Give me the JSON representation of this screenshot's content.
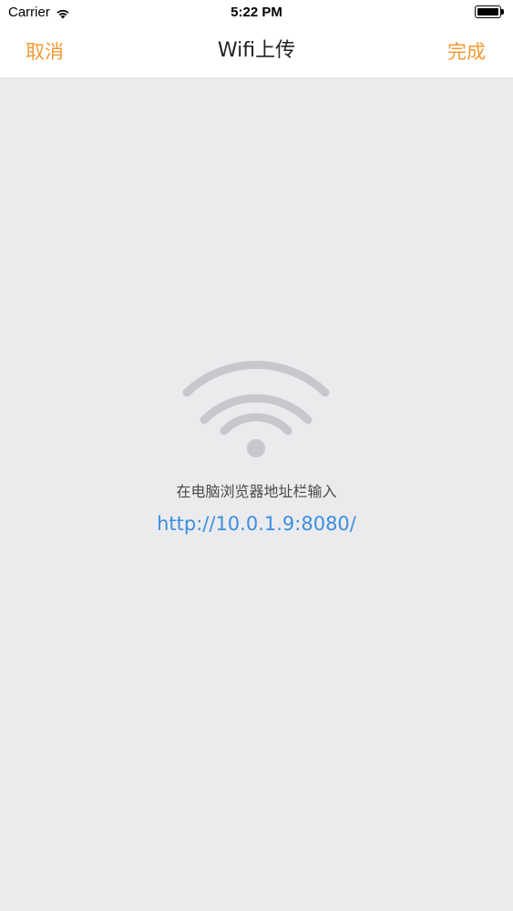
{
  "status_bar": {
    "carrier": "Carrier",
    "time": "5:22 PM",
    "signal_icon": "wifi-signal-icon",
    "battery_icon": "battery-icon"
  },
  "nav": {
    "cancel_label": "取消",
    "title": "Wifi上传",
    "done_label": "完成",
    "accent_color": "#f39a35"
  },
  "main": {
    "wifi_icon": "wifi-icon",
    "instruction": "在电脑浏览器地址栏输入",
    "url": "http://10.0.1.9:8080/",
    "url_color": "#3b8fe0",
    "background_color": "#ebebee",
    "icon_color": "#c6c8cc"
  }
}
